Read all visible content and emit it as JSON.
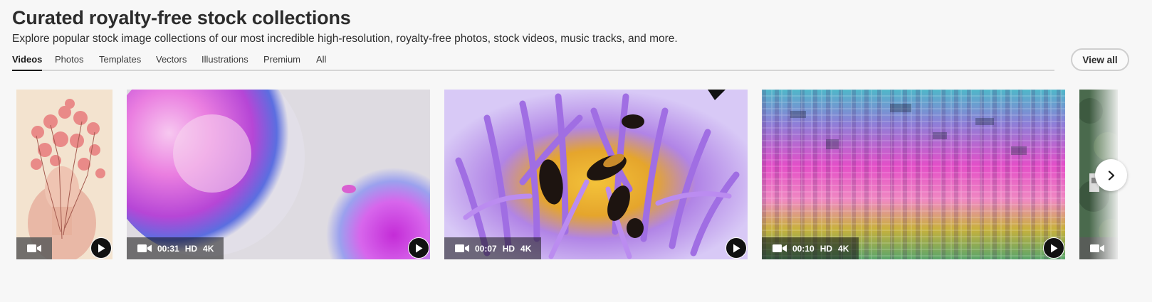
{
  "header": {
    "title": "Curated royalty-free stock collections",
    "subtitle": "Explore popular stock image collections of our most incredible high-resolution, royalty-free photos, stock videos, music tracks, and more."
  },
  "tabs": [
    {
      "label": "Videos",
      "active": true
    },
    {
      "label": "Photos",
      "active": false
    },
    {
      "label": "Templates",
      "active": false
    },
    {
      "label": "Vectors",
      "active": false
    },
    {
      "label": "Illustrations",
      "active": false
    },
    {
      "label": "Premium",
      "active": false
    },
    {
      "label": "All",
      "active": false
    }
  ],
  "view_all_label": "View all",
  "cards": [
    {
      "subject": "floral-portrait",
      "duration": "",
      "badges": []
    },
    {
      "subject": "purple-ink-bloom",
      "duration": "00:31",
      "badges": [
        "HD",
        "4K"
      ]
    },
    {
      "subject": "bees-in-lotus",
      "duration": "00:07",
      "badges": [
        "HD",
        "4K"
      ]
    },
    {
      "subject": "glitch-mosaic",
      "duration": "00:10",
      "badges": [
        "HD",
        "4K"
      ]
    },
    {
      "subject": "aerial-trees",
      "duration": "",
      "badges": []
    }
  ],
  "icons": {
    "camera": "video-camera-icon",
    "play": "play-icon",
    "next": "chevron-right-icon"
  },
  "colors": {
    "background": "#f7f7f7",
    "text": "#2c2c2c",
    "tab_rule": "#d5d5d5",
    "play_button": "#111111"
  }
}
